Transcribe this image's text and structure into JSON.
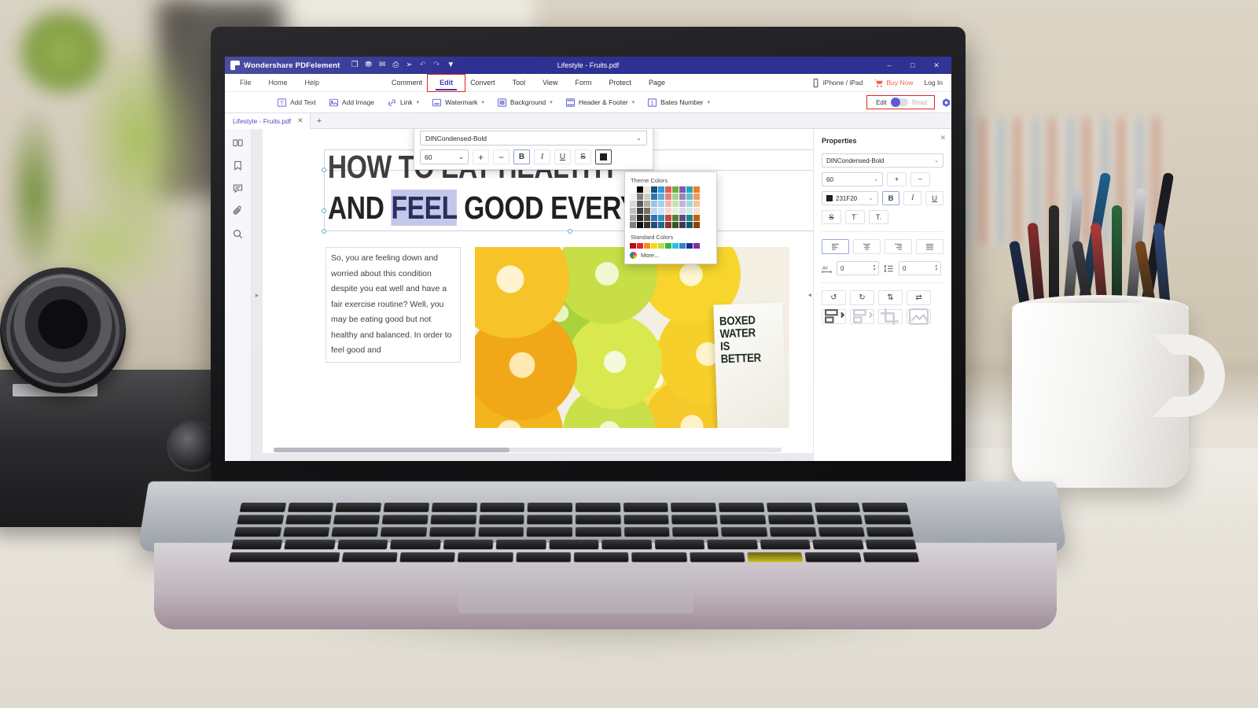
{
  "titlebar": {
    "app_name": "Wondershare PDFelement",
    "document_title": "Lifestyle - Fruits.pdf",
    "quick_access": [
      {
        "name": "open-icon",
        "glyph": "❐"
      },
      {
        "name": "save-icon",
        "glyph": "⛃"
      },
      {
        "name": "email-icon",
        "glyph": "✉"
      },
      {
        "name": "print-icon",
        "glyph": "⎙"
      },
      {
        "name": "share-icon",
        "glyph": "➢"
      },
      {
        "name": "undo-icon",
        "glyph": "↶"
      },
      {
        "name": "redo-icon",
        "glyph": "↷"
      },
      {
        "name": "customize-quick-access-icon",
        "glyph": "▼"
      }
    ],
    "window_controls": {
      "minimize": "–",
      "maximize": "□",
      "close": "✕"
    }
  },
  "menubar": {
    "left": [
      "File",
      "Home",
      "Help"
    ],
    "middle": [
      "Comment",
      "Edit",
      "Convert",
      "Tool",
      "View",
      "Form",
      "Protect",
      "Page"
    ],
    "active": "Edit",
    "right": [
      {
        "label": "iPhone / iPad",
        "icon": "phone-icon"
      },
      {
        "label": "Buy Now",
        "icon": "cart-icon"
      },
      {
        "label": "Log In",
        "icon": ""
      }
    ]
  },
  "ribbon": {
    "items": [
      {
        "label": "Add Text",
        "icon": "add-text-icon",
        "caret": false
      },
      {
        "label": "Add Image",
        "icon": "add-image-icon",
        "caret": false
      },
      {
        "label": "Link",
        "icon": "link-icon",
        "caret": true
      },
      {
        "label": "Watermark",
        "icon": "watermark-icon",
        "caret": true
      },
      {
        "label": "Background",
        "icon": "background-icon",
        "caret": true
      },
      {
        "label": "Header & Footer",
        "icon": "header-footer-icon",
        "caret": true
      },
      {
        "label": "Bates Number",
        "icon": "bates-number-icon",
        "caret": true
      }
    ],
    "mode_toggle": {
      "left_label": "Edit",
      "right_label": "Read",
      "state": "Edit"
    },
    "settings_icon": "settings-hex-icon"
  },
  "tabbar": {
    "tab_label": "Lifestyle - Fruits.pdf",
    "close_glyph": "✕",
    "new_tab_glyph": "+"
  },
  "sidebar": {
    "items": [
      {
        "name": "thumbnails-icon",
        "label": "Thumbnails"
      },
      {
        "name": "bookmark-icon",
        "label": "Bookmarks"
      },
      {
        "name": "comment-icon",
        "label": "Comments"
      },
      {
        "name": "attachment-icon",
        "label": "Attachments"
      },
      {
        "name": "search-icon",
        "label": "Search"
      }
    ]
  },
  "document": {
    "heading_line1_pre": "HOW TO ",
    "heading_line1_post": "EAT HEALTHY",
    "heading_line2_pre": "AND ",
    "heading_line2_sel": "FEEL",
    "heading_line2_post": " GOOD EVERY DAY",
    "body_text": "So, you are feeling down and worried about this condition despite you eat well and have a fair exercise routine? Well, you may be eating good but not healthy and balanced. In order to feel good and",
    "image_caption_lines": [
      "BOXED",
      "WATER",
      "IS",
      "BETTER"
    ]
  },
  "float_toolbar": {
    "font_family": "DINCondensed-Bold",
    "font_size": "60",
    "increase_glyph": "+",
    "decrease_glyph": "−",
    "bold": "B",
    "italic": "I",
    "underline": "U",
    "strikethrough": "S",
    "color_label": "Font Color"
  },
  "color_popup": {
    "theme_title": "Theme Colors",
    "standard_title": "Standard Colors",
    "more_label": "More...",
    "theme_columns": [
      [
        "#ffffff",
        "#f2f2f2",
        "#d8d8d8",
        "#bfbfbf",
        "#a5a5a5",
        "#7f7f7f"
      ],
      [
        "#000000",
        "#808080",
        "#595959",
        "#404040",
        "#262626",
        "#0d0d0d"
      ],
      [
        "#e7e6e0",
        "#d0cec2",
        "#afaca0",
        "#767264",
        "#4f4c41",
        "#35332b"
      ],
      [
        "#1f4e79",
        "#2e75b6",
        "#9dc3e6",
        "#bdd7ee",
        "#2e75b6",
        "#1f4e79"
      ],
      [
        "#2e9bd6",
        "#5aafdd",
        "#9fd2ee",
        "#c7e5f7",
        "#2f8fc4",
        "#1e6b93"
      ],
      [
        "#e05c4e",
        "#ea8076",
        "#f3b4ad",
        "#f8d5d1",
        "#c0483c",
        "#8e342b"
      ],
      [
        "#70ad47",
        "#a9d18e",
        "#c5e0b4",
        "#e2f0d9",
        "#548235",
        "#375623"
      ],
      [
        "#7b5ea7",
        "#9b83bf",
        "#c3b3d8",
        "#e0d8ec",
        "#614c85",
        "#443560"
      ],
      [
        "#2aa6b0",
        "#5fc0c8",
        "#9cd9de",
        "#cbecee",
        "#1f8189",
        "#145a60"
      ],
      [
        "#ef7d22",
        "#f3995a",
        "#f8c29b",
        "#fbe0cd",
        "#c25f12",
        "#8d440c"
      ]
    ],
    "standard_colors": [
      "#b01116",
      "#e8252b",
      "#f2901a",
      "#ffd31a",
      "#b6e03a",
      "#35b54a",
      "#2bc0d8",
      "#2f7fd4",
      "#1f2f8f",
      "#7d2fa0"
    ]
  },
  "properties": {
    "title": "Properties",
    "close_glyph": "✕",
    "font_family": "DINCondensed-Bold",
    "font_size": "60",
    "increase_glyph": "+",
    "decrease_glyph": "−",
    "color_value": "231F20",
    "bold": "B",
    "italic": "I",
    "underline": "U",
    "strikethrough": "S",
    "superscript": "T˙",
    "subscript": "T.",
    "align_buttons": [
      "align-left-icon",
      "align-center-icon",
      "align-right-icon",
      "align-justify-icon"
    ],
    "char_spacing": "0",
    "line_spacing": "0",
    "char_spacing_icon": "character-spacing-icon",
    "line_spacing_icon": "line-spacing-icon",
    "transform_buttons": [
      {
        "name": "rotate-left-icon",
        "glyph": "↺"
      },
      {
        "name": "rotate-right-icon",
        "glyph": "↻"
      },
      {
        "name": "flip-vertical-icon",
        "glyph": "⇅"
      },
      {
        "name": "flip-horizontal-icon",
        "glyph": "⇄"
      }
    ],
    "object_buttons": [
      {
        "name": "align-objects-icon",
        "glyph": "⌸"
      },
      {
        "name": "distribute-objects-icon",
        "glyph": "⌸"
      },
      {
        "name": "crop-icon",
        "glyph": "✀"
      },
      {
        "name": "replace-image-icon",
        "glyph": "ὛB"
      }
    ]
  },
  "accents": {
    "brand_blue": "#2e3192",
    "link_purple": "#3a3ab5",
    "highlight_red": "#e2231a",
    "buy_now": "#f0624d",
    "selection_blue": "#c3c8e8"
  }
}
